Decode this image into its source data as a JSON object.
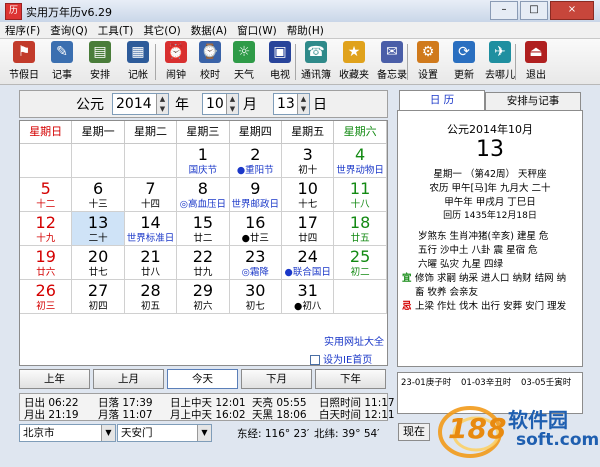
{
  "window": {
    "title": "实用万年历v6.29",
    "app_icon": "历",
    "min": "–",
    "max": "□",
    "close": "×"
  },
  "menu": [
    "程序(F)",
    "查询(Q)",
    "工具(T)",
    "其它(O)",
    "数据(A)",
    "窗口(W)",
    "帮助(H)"
  ],
  "toolbar": [
    {
      "label": "节假日",
      "icon": "flag-icon",
      "color": "#c23b2b",
      "glyph": "⚑"
    },
    {
      "label": "记事",
      "icon": "pen-icon",
      "color": "#3b6fb0",
      "glyph": "✎"
    },
    {
      "label": "安排",
      "icon": "schedule-icon",
      "color": "#4a7d3a",
      "glyph": "▤"
    },
    {
      "label": "记帐",
      "icon": "ledger-icon",
      "color": "#2d5b9a",
      "glyph": "▦"
    },
    {
      "label": "闹钟",
      "icon": "alarm-clock-icon",
      "color": "#d83030",
      "glyph": "⏰"
    },
    {
      "label": "校时",
      "icon": "computer-icon",
      "color": "#3a63a8",
      "glyph": "⌚"
    },
    {
      "label": "天气",
      "icon": "weather-icon",
      "color": "#2f9b48",
      "glyph": "☼"
    },
    {
      "label": "电视",
      "icon": "tv-icon",
      "color": "#27439a",
      "glyph": "▣"
    },
    {
      "label": "通讯簿",
      "icon": "phone-book-icon",
      "color": "#2f8a8a",
      "glyph": "☎"
    },
    {
      "label": "收藏夹",
      "icon": "star-icon",
      "color": "#e0a21c",
      "glyph": "★"
    },
    {
      "label": "备忘录",
      "icon": "memo-icon",
      "color": "#4a5ea8",
      "glyph": "✉"
    },
    {
      "label": "设置",
      "icon": "settings-icon",
      "color": "#d07a1c",
      "glyph": "⚙"
    },
    {
      "label": "更新",
      "icon": "update-icon",
      "color": "#2a6fc0",
      "glyph": "⟳"
    },
    {
      "label": "去哪儿",
      "icon": "qunar-icon",
      "color": "#1f8fa0",
      "glyph": "✈"
    },
    {
      "label": "退出",
      "icon": "exit-icon",
      "color": "#b02020",
      "glyph": "⏏"
    }
  ],
  "date_select": {
    "prefix": "公元",
    "year": "2014",
    "year_label": "年",
    "month": "10",
    "month_label": "月",
    "day": "13",
    "day_label": "日"
  },
  "weekdays": [
    "星期日",
    "星期一",
    "星期二",
    "星期三",
    "星期四",
    "星期五",
    "星期六"
  ],
  "days": [
    {
      "d": "1",
      "l": "国庆节",
      "dc": "black",
      "lc": "blue"
    },
    {
      "d": "2",
      "l": "●重阳节",
      "dc": "black",
      "lc": "blue"
    },
    {
      "d": "3",
      "l": "初十",
      "dc": "black",
      "lc": "black"
    },
    {
      "d": "4",
      "l": "世界动物日",
      "dc": "green",
      "lc": "blue"
    },
    {
      "d": "5",
      "l": "十二",
      "dc": "red",
      "lc": "red"
    },
    {
      "d": "6",
      "l": "十三",
      "dc": "black",
      "lc": "black"
    },
    {
      "d": "7",
      "l": "十四",
      "dc": "black",
      "lc": "black"
    },
    {
      "d": "8",
      "l": "◎高血压日",
      "dc": "black",
      "lc": "blue"
    },
    {
      "d": "9",
      "l": "世界邮政日",
      "dc": "black",
      "lc": "blue"
    },
    {
      "d": "10",
      "l": "十七",
      "dc": "black",
      "lc": "black"
    },
    {
      "d": "11",
      "l": "十八",
      "dc": "green",
      "lc": "green"
    },
    {
      "d": "12",
      "l": "十九",
      "dc": "red",
      "lc": "red"
    },
    {
      "d": "13",
      "l": "二十",
      "dc": "black",
      "lc": "black"
    },
    {
      "d": "14",
      "l": "世界标准日",
      "dc": "black",
      "lc": "blue"
    },
    {
      "d": "15",
      "l": "廿二",
      "dc": "black",
      "lc": "black"
    },
    {
      "d": "16",
      "l": "●廿三",
      "dc": "black",
      "lc": "black"
    },
    {
      "d": "17",
      "l": "廿四",
      "dc": "black",
      "lc": "black"
    },
    {
      "d": "18",
      "l": "廿五",
      "dc": "green",
      "lc": "green"
    },
    {
      "d": "19",
      "l": "廿六",
      "dc": "red",
      "lc": "red"
    },
    {
      "d": "20",
      "l": "廿七",
      "dc": "black",
      "lc": "black"
    },
    {
      "d": "21",
      "l": "廿八",
      "dc": "black",
      "lc": "black"
    },
    {
      "d": "22",
      "l": "廿九",
      "dc": "black",
      "lc": "black"
    },
    {
      "d": "23",
      "l": "◎霜降",
      "dc": "black",
      "lc": "blue"
    },
    {
      "d": "24",
      "l": "●联合国日",
      "dc": "black",
      "lc": "blue"
    },
    {
      "d": "25",
      "l": "初二",
      "dc": "green",
      "lc": "green"
    },
    {
      "d": "26",
      "l": "初三",
      "dc": "red",
      "lc": "red"
    },
    {
      "d": "27",
      "l": "初四",
      "dc": "black",
      "lc": "black"
    },
    {
      "d": "28",
      "l": "初五",
      "dc": "black",
      "lc": "black"
    },
    {
      "d": "29",
      "l": "初六",
      "dc": "black",
      "lc": "black"
    },
    {
      "d": "30",
      "l": "初七",
      "dc": "black",
      "lc": "black"
    },
    {
      "d": "31",
      "l": "●初八",
      "dc": "black",
      "lc": "black"
    }
  ],
  "first_weekday": 3,
  "today_day": "13",
  "links": {
    "site": "实用网址大全",
    "homepage": "设为IE首页"
  },
  "nav": [
    "上年",
    "上月",
    "今天",
    "下月",
    "下年"
  ],
  "sun_moon": [
    [
      "日出 06:22",
      "日落 17:39",
      "日上中天 12:01",
      "天亮 05:55",
      "日照时间 11:17"
    ],
    [
      "月出 21:19",
      "月落 11:07",
      "月上中天 16:02",
      "天黑 18:06",
      "白天时间 12:11"
    ]
  ],
  "location": {
    "city": "北京市",
    "district": "天安门",
    "lon": "东经: 116° 23′",
    "lat": "北纬: 39° 54′"
  },
  "tabs": {
    "calendar": "日  历",
    "schedule": "安排与记事"
  },
  "detail": {
    "header": "公元2014年10月",
    "day": "13",
    "week_line": "星期一 （第42周）  天秤座",
    "lunar_line": "农历 甲午[马]年 九月大 二十",
    "ganzhi_line": "甲午年 甲戌月 丁巳日",
    "hui_line": "回历 1435年12月18日",
    "lines": [
      "岁煞东 生肖冲猪(辛亥) 建星 危",
      "五行 沙中土 八卦 震 星宿 危",
      "六曜 弘灾 九星 四绿"
    ],
    "yi_label": "宜",
    "yi": "修饰 求嗣 纳采 进人口 纳财 结网 纳",
    "yi2": "畜 牧养 会亲友",
    "ji_label": "忌",
    "ji": "上梁 作灶 伐木 出行 安葬 安门 理发"
  },
  "hours": [
    "23-01庚子时",
    "01-03辛丑时",
    "03-05壬寅时"
  ],
  "bottom_label": "现在",
  "watermark": {
    "num": "188",
    "text": "软件园",
    "url": "soft.com"
  }
}
